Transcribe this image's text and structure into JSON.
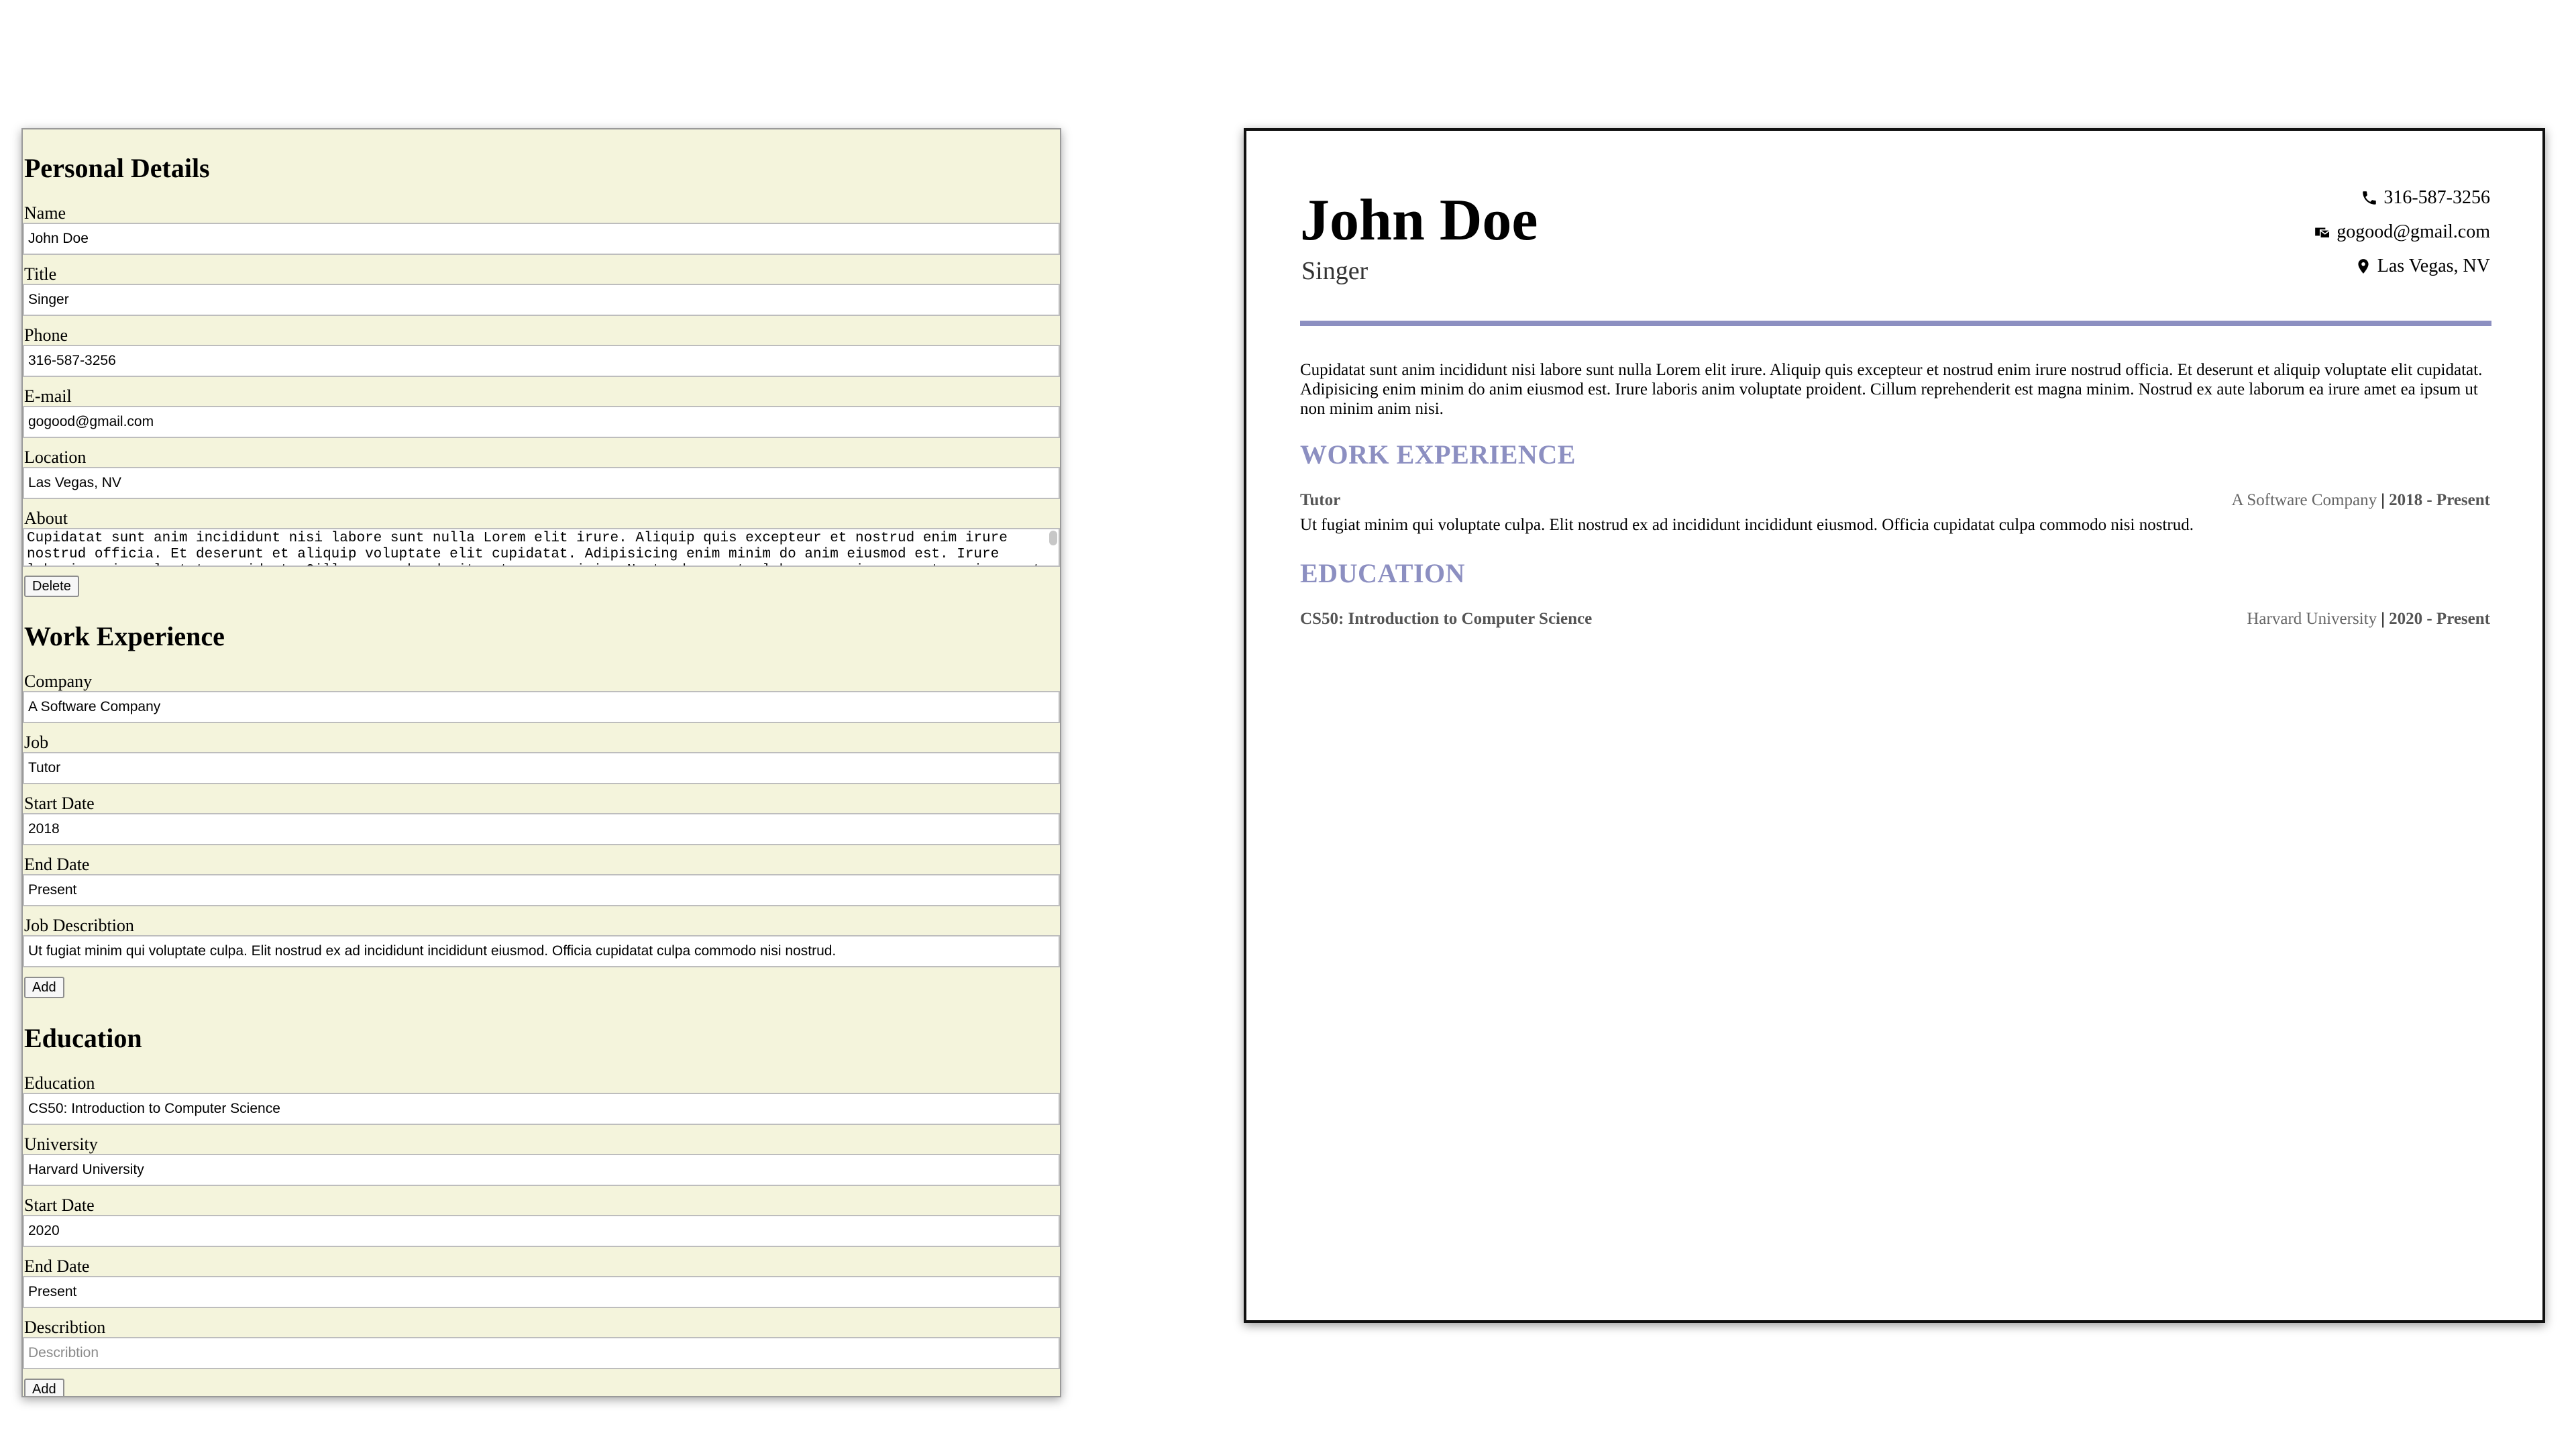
{
  "form": {
    "personal": {
      "heading": "Personal Details",
      "name_label": "Name",
      "name_value": "John Doe",
      "title_label": "Title",
      "title_value": "Singer",
      "phone_label": "Phone",
      "phone_value": "316-587-3256",
      "email_label": "E-mail",
      "email_value": "gogood@gmail.com",
      "location_label": "Location",
      "location_value": "Las Vegas, NV",
      "about_label": "About",
      "about_value": "Cupidatat sunt anim incididunt nisi labore sunt nulla Lorem elit irure. Aliquip quis excepteur et nostrud enim irure nostrud officia. Et deserunt et aliquip voluptate elit cupidatat. Adipisicing enim minim do anim eiusmod est. Irure laboris anim voluptate proident. Cillum reprehenderit est magna minim. Nostrud ex aute laborum ea irure amet ea ipsum ut non minim anim nisi.",
      "delete_button": "Delete"
    },
    "work": {
      "heading": "Work Experience",
      "company_label": "Company",
      "company_value": "A Software Company",
      "job_label": "Job",
      "job_value": "Tutor",
      "start_label": "Start Date",
      "start_value": "2018",
      "end_label": "End Date",
      "end_value": "Present",
      "desc_label": "Job Describtion",
      "desc_value": "Ut fugiat minim qui voluptate culpa. Elit nostrud ex ad incididunt incididunt eiusmod. Officia cupidatat culpa commodo nisi nostrud.",
      "add_button": "Add"
    },
    "education": {
      "heading": "Education",
      "education_label": "Education",
      "education_value": "CS50: Introduction to Computer Science",
      "university_label": "University",
      "university_value": "Harvard University",
      "start_label": "Start Date",
      "start_value": "2020",
      "end_label": "End Date",
      "end_value": "Present",
      "desc_label": "Describtion",
      "desc_placeholder": "Describtion",
      "add_button": "Add"
    }
  },
  "resume": {
    "name": "John Doe",
    "title": "Singer",
    "contact": {
      "phone": "316-587-3256",
      "phone_icon": "phone-icon",
      "email": "gogood@gmail.com",
      "email_icon": "mail-icon",
      "location": "Las Vegas, NV",
      "location_icon": "map-pin-icon"
    },
    "about": "Cupidatat sunt anim incididunt nisi labore sunt nulla Lorem elit irure. Aliquip quis excepteur et nostrud enim irure nostrud officia. Et deserunt et aliquip voluptate elit cupidatat. Adipisicing enim minim do anim eiusmod est. Irure laboris anim voluptate proident. Cillum reprehenderit est magna minim. Nostrud ex aute laborum ea irure amet ea ipsum ut non minim anim nisi.",
    "work_heading": "WORK EXPERIENCE",
    "work": {
      "job": "Tutor",
      "company": "A Software Company",
      "separator": "|",
      "dates": "2018 - Present",
      "description": "Ut fugiat minim qui voluptate culpa. Elit nostrud ex ad incididunt incididunt eiusmod. Officia cupidatat culpa commodo nisi nostrud."
    },
    "education_heading": "EDUCATION",
    "education": {
      "course": "CS50: Introduction to Computer Science",
      "university": "Harvard University",
      "separator": "|",
      "dates": "2020 - Present"
    }
  },
  "colors": {
    "form_background": "#f4f4dc",
    "accent": "#8c8fc1"
  }
}
